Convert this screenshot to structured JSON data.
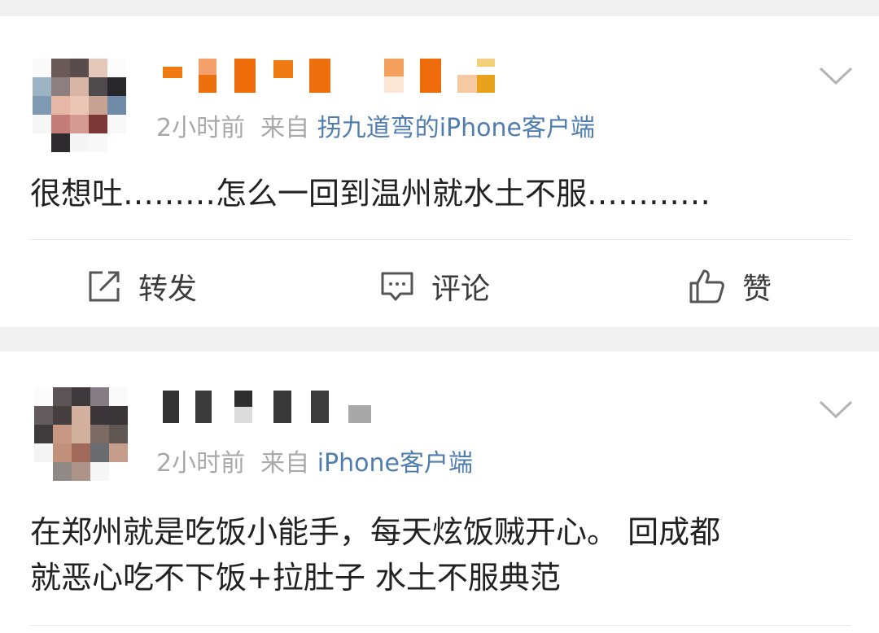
{
  "posts": [
    {
      "time": "2小时前",
      "from_label": "来自",
      "source": "拐九道弯的iPhone客户端",
      "text": "很想吐………怎么一回到温州就水土不服…………",
      "actions": {
        "repost": "转发",
        "comment": "评论",
        "like": "赞"
      }
    },
    {
      "time": "2小时前",
      "from_label": "来自",
      "source": "iPhone客户端",
      "text": "在郑州就是吃饭小能手，每天炫饭贼开心。 回成都\n就恶心吃不下饭+拉肚子 水土不服典范"
    }
  ],
  "icons": {
    "repost": "repost-icon",
    "comment": "comment-icon",
    "like": "thumbs-up-icon",
    "menu": "chevron-down-icon"
  },
  "colors": {
    "source_link": "#507daf",
    "meta_text": "#a9a9a9",
    "separator_bg": "#f1f1f1"
  }
}
